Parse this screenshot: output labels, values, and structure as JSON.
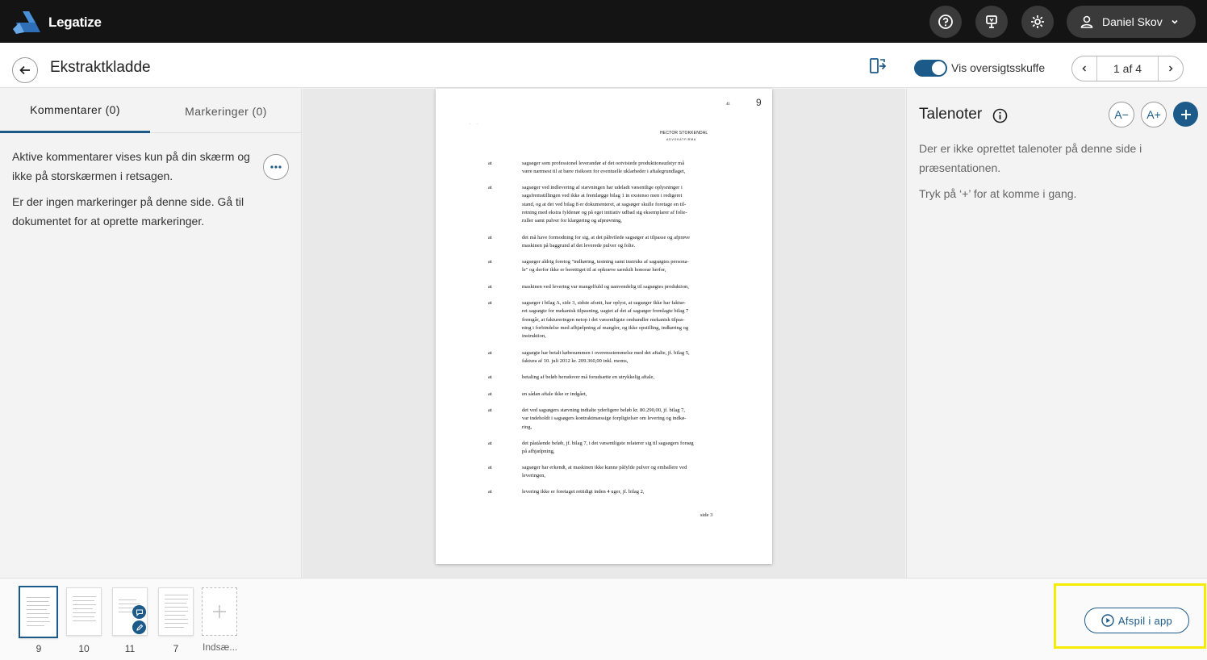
{
  "app": {
    "name": "Legatize"
  },
  "topbar": {
    "icons": [
      "help-icon",
      "presenter-icon",
      "settings-icon"
    ],
    "user_name": "Daniel Skov"
  },
  "header": {
    "title": "Ekstraktkladde",
    "toggle_label": "Vis oversigtsskuffe",
    "toggle_on": true,
    "pager_text": "1 af 4"
  },
  "left_panel": {
    "tab_comments": "Kommentarer (0)",
    "tab_markings": "Markeringer (0)",
    "text1": "Aktive kommentarer vises kun på din skærm og ikke på storskærmen i retsagen.",
    "text2": "Er der ingen markeringer på denne side. Gå til dokumentet for at oprette markeringer."
  },
  "document": {
    "page_number": "9",
    "corner_mark": "41",
    "letterhead": "HECTOR STOKKENDAL",
    "letterhead_sub": "ADVOKATFIRMA",
    "footer": "side 3",
    "paragraphs": [
      {
        "label": "at",
        "lines": [
          "sagsøger som professionel leverandør af det ootvistede produktionsudstyr må",
          "være nærmest til at bære risikoen for eventuelle uklarheder i aftalegrundlaget,"
        ]
      },
      {
        "label": "at",
        "lines": [
          "sagsøger ved indlevering af stævningen har udeladt væsentlige oplysninger i",
          "sagsfremstillingen ved ikke at fremlægge bilag 1 in exstenso men i redigeret",
          "stand, og at det ved bilag 8 er dokumenteret, at sagsøger skulle foretage en til-",
          "retning med ekstra fyldenør og på eget initiativ udbad sig eksemplarer af folie-",
          "ruller samt pulver for klargøring og afprøvning,"
        ]
      },
      {
        "label": "at",
        "lines": [
          "det må have formodning for sig, at det påhvilede sagsøger at tilpasse og afprøve",
          "maskinen på baggrund af det leverede pulver og folie."
        ]
      },
      {
        "label": "at",
        "lines": [
          "sagsøger aldrig foretog \"indkøring, testning samt instruks af sagsøgtes persona-",
          "le\" og derfor ikke er berettiget til at opkræve særskilt honorar herfor,"
        ]
      },
      {
        "label": "at",
        "lines": [
          "maskinen ved levering var mangelfuld og uanvendelig til sagsøgtes produktion,"
        ]
      },
      {
        "label": "at",
        "lines": [
          "sagsøger i bilag A, side 3, sidste afsnit, har oplyst, at sagsøger ikke har faktur-",
          "ret sagsøgte for mekanisk tilpasning, uagtet af det af sagsøger fremlagte bilag 7",
          "fremgår, at faktureringen netop i det væsentligste omhandler mekanisk tilpas-",
          "ning i forbindelse med afhjælpning af mangler, og ikke opstilling, indkøring og",
          "instruktion,"
        ]
      },
      {
        "label": "at",
        "lines": [
          "sagsøgte har betalt købesummen i overensstemmelse med det aftalte, jf. bilag 5,",
          "faktura af 10. juli 2012 kr. 209.360,00 inkl. moms,"
        ]
      },
      {
        "label": "at",
        "lines": [
          "betaling af beløb herudover må forudsætte en utrykkelig aftale,"
        ]
      },
      {
        "label": "at",
        "lines": [
          "en sådan aftale ikke er indgået,"
        ]
      },
      {
        "label": "at",
        "lines": [
          "det ved sagsøgers stævning indtalte yderligere beløb kr. 80.290,00, jf. bilag 7,",
          "var indeholdt i sagsøgers kontraktmæssige forpligtelser om levering og indkø-",
          "ring,"
        ]
      },
      {
        "label": "at",
        "lines": [
          "det påstående beløb, jf. bilag 7, i det væsentligste relaterer sig til sagsøgers forsøg",
          "på afhjælpning,"
        ]
      },
      {
        "label": "at",
        "lines": [
          "sagsøger har erkendt, at maskinen ikke kunne påfylde pulver og emballere ved",
          "leveringen,"
        ]
      },
      {
        "label": "at",
        "lines": [
          "levering ikke er foretaget rettidigt inden 4 uger, jf. bilag 2,"
        ]
      }
    ]
  },
  "right_panel": {
    "title": "Talenoter",
    "font_decrease": "A−",
    "font_increase": "A+",
    "text1": "Der er ikke oprettet talenoter på denne side i præsentationen.",
    "text2": "Tryk på ‘+’ for at komme i gang."
  },
  "thumbnails": [
    {
      "number": "9",
      "selected": true,
      "badges": []
    },
    {
      "number": "10",
      "selected": false,
      "badges": []
    },
    {
      "number": "11",
      "selected": false,
      "badges": [
        "comment-icon",
        "edit-icon"
      ]
    },
    {
      "number": "7",
      "selected": false,
      "badges": []
    }
  ],
  "insert_label": "Indsæ...",
  "play_button": "Afspil i app",
  "colors": {
    "accent": "#1c5a8a",
    "topbar": "#141414",
    "highlight": "#f5ec00"
  }
}
